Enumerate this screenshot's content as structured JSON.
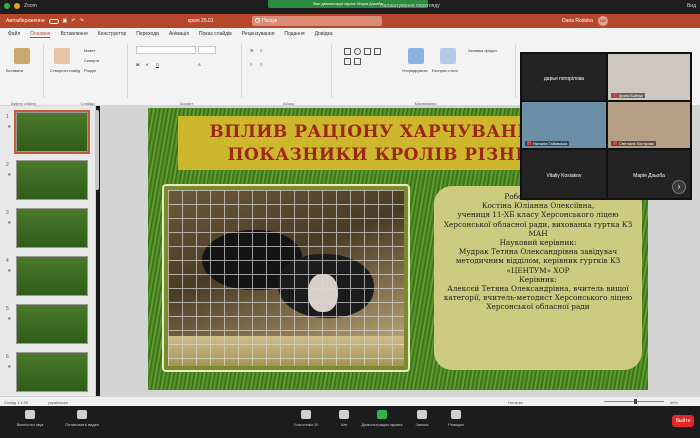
{
  "zoom": {
    "app_label": "Zoom",
    "recording_banner": "Вас демонструє екран: Марія Дзьоба",
    "view_label": "Налаштування перегляду",
    "view_mode": "Вид",
    "controls": {
      "mute": "Включити звук",
      "video": "Остановить видео",
      "participants": "Участники",
      "participants_count": "10",
      "chat": "Чат",
      "share": "Демонстрация экрана",
      "record": "Запись",
      "reactions": "Реакции",
      "end": "Выйти"
    },
    "participants": [
      {
        "name": "дарья погорілова"
      },
      {
        "name": "Ірина Бойчук"
      },
      {
        "name": "Наталія Гайовська"
      },
      {
        "name": "Світлана Кострова"
      },
      {
        "name": "Vitaliy Kosiakov"
      },
      {
        "name": "Марія Дзьоба"
      }
    ]
  },
  "ppt": {
    "autosave_label": "Автозбереження",
    "filename": "кролі 25.01",
    "search_placeholder": "Пошук",
    "user_name": "Daria Roduba",
    "user_initials": "DR",
    "tabs": [
      "Файл",
      "Основне",
      "Вставлення",
      "Конструктор",
      "Переходи",
      "Анімація",
      "Показ слайдів",
      "Рецензування",
      "Подання",
      "Довідка"
    ],
    "active_tab": "Основне",
    "ribbon": {
      "paste": "Вставити",
      "clipboard": "Буфер обміну",
      "new_slide": "Створити слайд",
      "reuse": "Повторне",
      "layout": "Макет",
      "reset": "Скинути",
      "section": "Розділ",
      "slides": "Слайди",
      "font": "Шрифт",
      "paragraph": "Абзац",
      "arrange": "Упорядкувати",
      "quick_styles": "Експрес-стилі",
      "drawing": "Малювання",
      "fill": "Заливка фігури",
      "outline": "Контур фігури",
      "effects": "Ефекти фігур"
    },
    "slide_count_label": "Слайд 1 з 35",
    "language": "українська",
    "notes_label": "Нотатки",
    "zoom_pct": "66%"
  },
  "slide": {
    "title_line1": "ВПЛИВ РАЦІОНУ ХАРЧУВАННЯ НА",
    "title_line2": "ПОКАЗНИКИ КРОЛІВ РІЗНИХ П",
    "info": [
      "Роботу виконала:",
      "Костіна Юліанна Олексіївна,",
      "учениця 11-ХБ класу Херсонського ліцею",
      "Херсонської обласної ради, вихованка гуртка КЗ",
      "МАН",
      "Науковий керівник:",
      "Мудрак Тетяна Олександрівна завідувач",
      "методичним відділом, керівник гуртків КЗ",
      "«ЦЕНТУМ» ХОР",
      "Керівник:",
      "Алексєй Тетяна Олександрівна, вчитель вищої",
      "категорії, вчитель-методист Херсонського ліцею",
      "Херсонської обласної ради"
    ]
  },
  "thumbnails": [
    "1",
    "2",
    "3",
    "4",
    "5",
    "6"
  ]
}
